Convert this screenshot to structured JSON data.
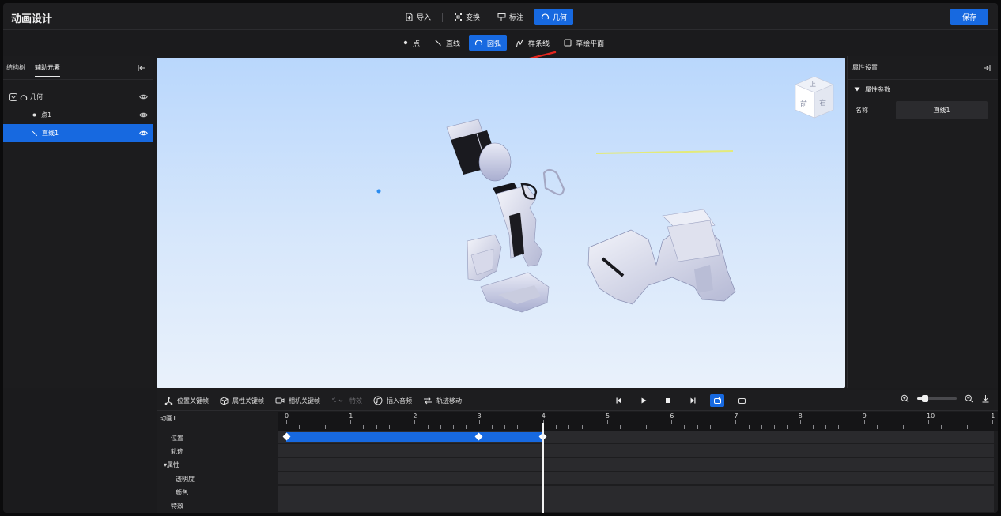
{
  "app_title": "动画设计",
  "top_tools": [
    {
      "label": "导入",
      "icon": "import-icon",
      "active": false
    },
    {
      "label": "变换",
      "icon": "transform-icon",
      "active": false
    },
    {
      "label": "标注",
      "icon": "annotate-icon",
      "active": false
    },
    {
      "label": "几何",
      "icon": "arc-icon",
      "active": true
    }
  ],
  "save_label": "保存",
  "sub_tools": [
    {
      "label": "点",
      "icon": "dot-icon",
      "active": false
    },
    {
      "label": "直线",
      "icon": "line-icon",
      "active": false
    },
    {
      "label": "圆弧",
      "icon": "arc-icon",
      "active": true
    },
    {
      "label": "样条线",
      "icon": "spline-icon",
      "active": false
    },
    {
      "label": "草绘平面",
      "icon": "plane-icon",
      "active": false
    }
  ],
  "left_panel": {
    "tabs": [
      {
        "label": "结构树",
        "active": false
      },
      {
        "label": "辅助元素",
        "active": true
      }
    ],
    "tree": [
      {
        "label": "几何",
        "level": 0,
        "selected": false
      },
      {
        "label": "点1",
        "level": 1,
        "selected": false
      },
      {
        "label": "直线1",
        "level": 1,
        "selected": true
      }
    ]
  },
  "viewcube": {
    "top": "上",
    "front": "前",
    "right": "右"
  },
  "right_panel": {
    "title": "属性设置",
    "section": "属性参数",
    "fields": [
      {
        "label": "名称",
        "value": "直线1"
      }
    ]
  },
  "timeline": {
    "toolbar": [
      {
        "label": "位置关键帧",
        "icon": "position-keyframe-icon",
        "enabled": true
      },
      {
        "label": "属性关键帧",
        "icon": "property-keyframe-icon",
        "enabled": true
      },
      {
        "label": "相机关键帧",
        "icon": "camera-keyframe-icon",
        "enabled": true
      },
      {
        "label": "特效",
        "icon": "effect-icon",
        "enabled": false
      },
      {
        "label": "插入音频",
        "icon": "audio-icon",
        "enabled": true
      },
      {
        "label": "轨迹移动",
        "icon": "trajectory-icon",
        "enabled": true
      }
    ],
    "zoom_level": 0.2,
    "animation_name": "动画1",
    "tracks": [
      {
        "label": "位置",
        "indent": 1
      },
      {
        "label": "轨迹",
        "indent": 1
      },
      {
        "label": "▾属性",
        "indent": 0
      },
      {
        "label": "透明度",
        "indent": 2
      },
      {
        "label": "颜色",
        "indent": 2
      },
      {
        "label": "特效",
        "indent": 1
      }
    ],
    "ruler_ticks": [
      "0",
      "1",
      "2",
      "3",
      "4",
      "5",
      "6",
      "7",
      "8",
      "9",
      "10",
      "1"
    ],
    "keyframes": [
      0,
      3,
      4
    ],
    "segment": [
      0,
      4
    ],
    "playhead": 4
  }
}
